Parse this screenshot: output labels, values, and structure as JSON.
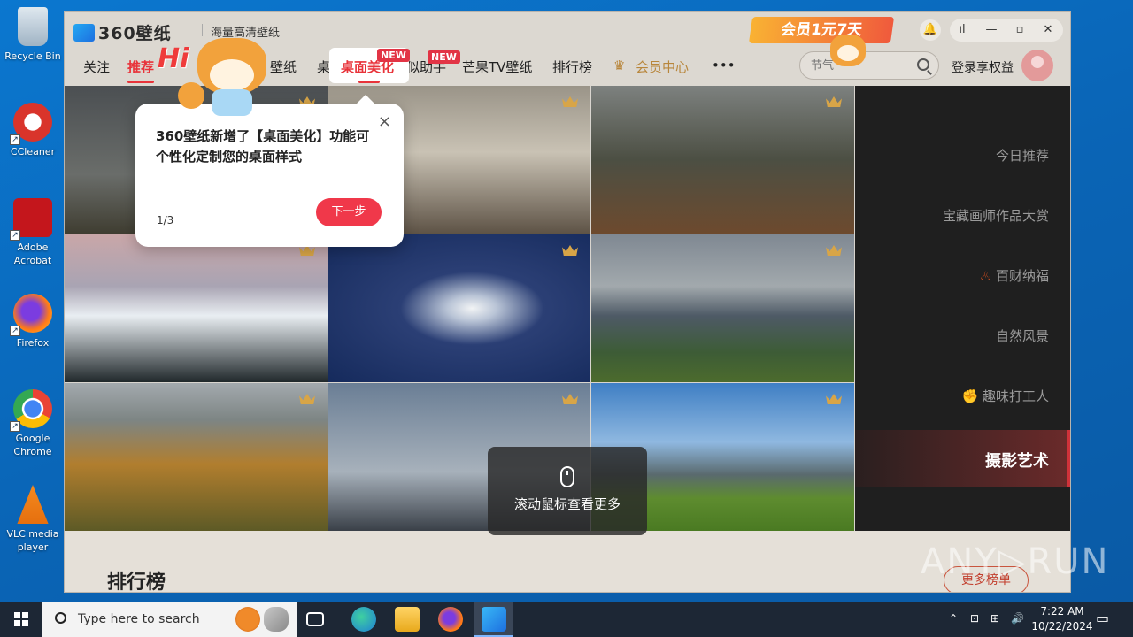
{
  "desktop": {
    "icons": [
      {
        "label": "Recycle Bin"
      },
      {
        "label": "CCleaner"
      },
      {
        "label": "Adobe Acrobat"
      },
      {
        "label": "Firefox"
      },
      {
        "label": "Google Chrome"
      },
      {
        "label": "VLC media player"
      }
    ]
  },
  "app": {
    "logo_text": "360壁纸",
    "subtitle": "海量高清壁纸",
    "promo": "会员1元7天",
    "nav": {
      "items": [
        "关注",
        "推荐",
        "壁纸",
        "桌",
        "桌面美化",
        "似助手",
        "芒果TV壁纸",
        "排行榜",
        "会员中心",
        "•••"
      ],
      "new_badge": "NEW"
    },
    "search": {
      "placeholder": "节气"
    },
    "login": "登录享权益",
    "mascot_text": "Hi",
    "popup": {
      "text": "360壁纸新增了【桌面美化】功能可个性化定制您的桌面样式",
      "step": "1/3",
      "next": "下一步",
      "close": "×"
    },
    "categories": [
      "今日推荐",
      "宝藏画师作品大赏",
      "百财纳福",
      "自然风景",
      "趣味打工人",
      "摄影艺术"
    ],
    "scroll_hint": "滚动鼠标查看更多",
    "ranking_title": "排行榜",
    "more_button": "更多榜单"
  },
  "watermark": "ANY▷RUN",
  "taskbar": {
    "search_placeholder": "Type here to search",
    "time": "7:22 AM",
    "date": "10/22/2024"
  },
  "colors": {
    "accent": "#e8333a",
    "panel": "#1f1f1f",
    "taskbar": "#1d2735"
  }
}
